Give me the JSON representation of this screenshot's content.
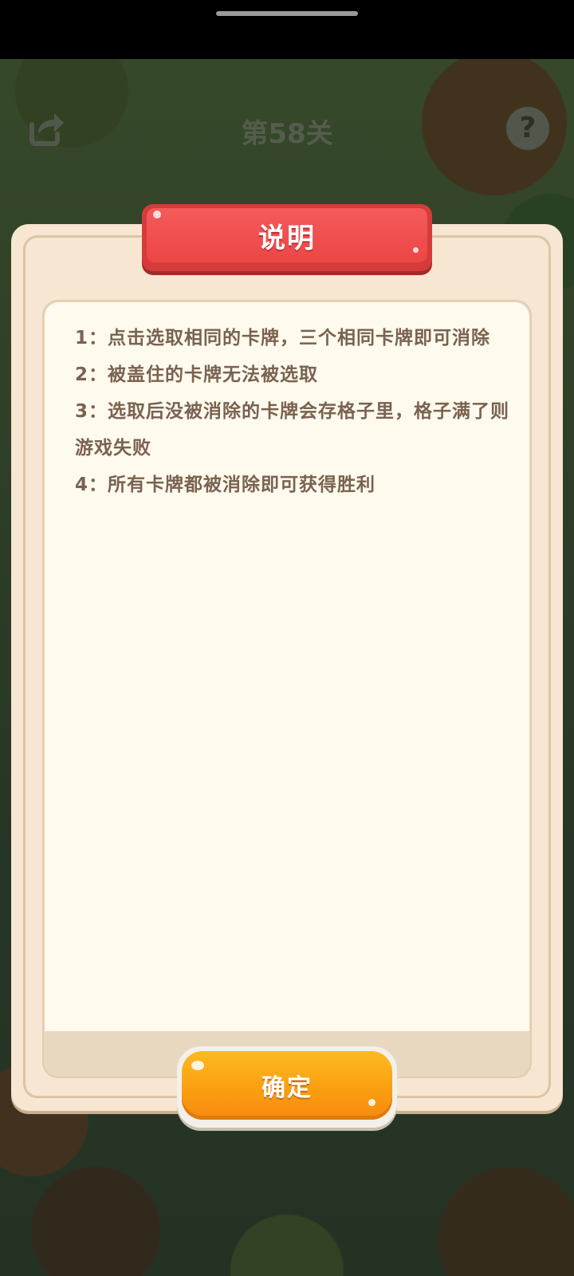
{
  "header": {
    "level_title": "第58关",
    "share_icon": "share-icon",
    "help_icon": "help-icon",
    "help_glyph": "?"
  },
  "dialog": {
    "title": "说明",
    "rules": [
      "1：点击选取相同的卡牌，三个相同卡牌即可消除",
      "2：被盖住的卡牌无法被选取",
      "3：选取后没被消除的卡牌会存格子里，格子满了则游戏失败",
      "4：所有卡牌都被消除即可获得胜利"
    ],
    "confirm_label": "确定"
  },
  "colors": {
    "title_banner": "#ec4646",
    "confirm_button": "#fb9c10",
    "panel": "#f6e6d2",
    "rule_text": "#7a6250"
  }
}
